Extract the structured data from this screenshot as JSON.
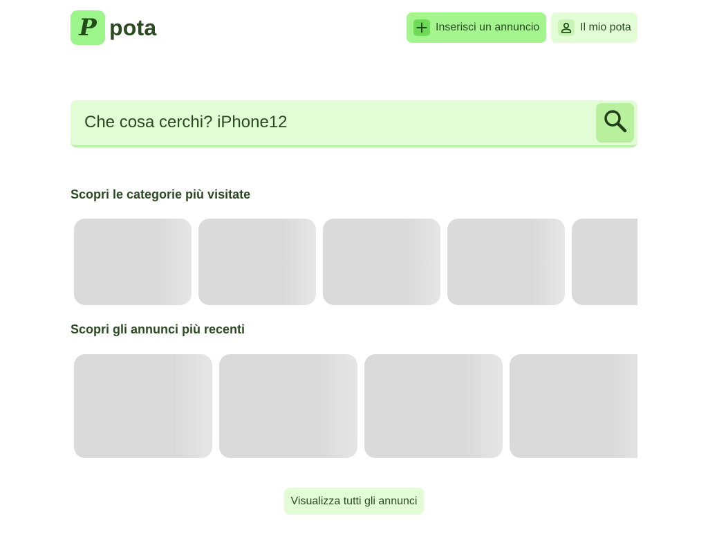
{
  "header": {
    "logo_letter": "P",
    "logo_text": "pota",
    "insert_label": "Inserisci un annuncio",
    "account_label": "Il mio pota"
  },
  "search": {
    "placeholder": "Che cosa cerchi? iPhone12",
    "button_icon": "search-icon"
  },
  "categories": {
    "title": "Scopri le categorie più visitate",
    "card_count": 5
  },
  "recent": {
    "title": "Scopri gli annunci più recenti",
    "card_count": 4
  },
  "footer": {
    "view_all_label": "Visualizza tutti gli annunci"
  },
  "colors": {
    "brand_green": "#9cf58a",
    "brand_dark": "#2b4a22",
    "light_green": "#e2fdd6",
    "placeholder_gray": "#dadada"
  }
}
